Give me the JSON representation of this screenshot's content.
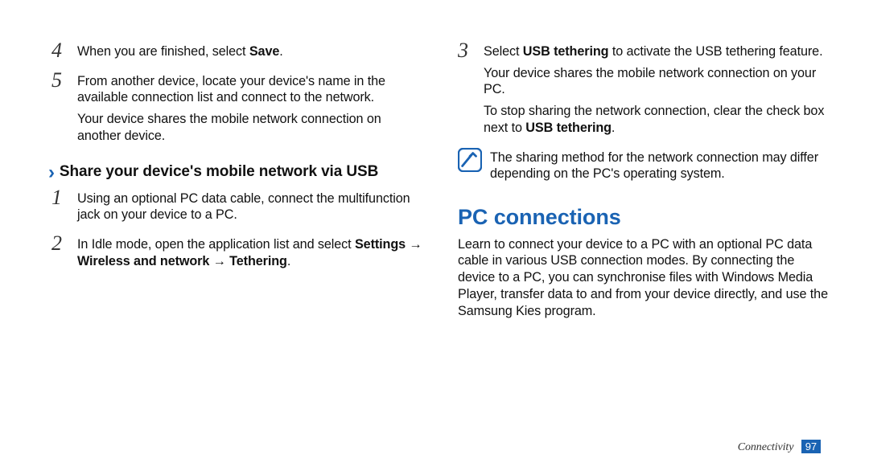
{
  "left": {
    "step4": {
      "num": "4",
      "text_a": "When you are finished, select ",
      "bold_b": "Save",
      "text_c": "."
    },
    "step5": {
      "num": "5",
      "p1": "From another device, locate your device's name in the available connection list and connect to the network.",
      "p2": "Your device shares the mobile network connection on another device."
    },
    "sub_heading": "Share your device's mobile network via USB",
    "step1": {
      "num": "1",
      "p1": "Using an optional PC data cable, connect the multifunction jack on your device to a PC."
    },
    "step2": {
      "num": "2",
      "text_a": "In Idle mode, open the application list and select ",
      "bold_b": "Settings",
      "arrow1": " → ",
      "bold_c": "Wireless and network",
      "arrow2": " → ",
      "bold_d": "Tethering",
      "text_e": "."
    }
  },
  "right": {
    "step3": {
      "num": "3",
      "text_a": "Select ",
      "bold_b": "USB tethering",
      "text_c": " to activate the USB tethering feature.",
      "p2": "Your device shares the mobile network connection on your PC.",
      "p3_a": "To stop sharing the network connection, clear the check box next to ",
      "p3_bold": "USB tethering",
      "p3_c": "."
    },
    "note": "The sharing method for the network connection may differ depending on the PC's operating system.",
    "section_heading": "PC connections",
    "section_para": "Learn to connect your device to a PC with an optional PC data cable in various USB connection modes. By connecting the device to a PC, you can synchronise files with Windows Media Player, transfer data to and from your device directly, and use the Samsung Kies program."
  },
  "footer": {
    "section": "Connectivity",
    "page": "97"
  }
}
